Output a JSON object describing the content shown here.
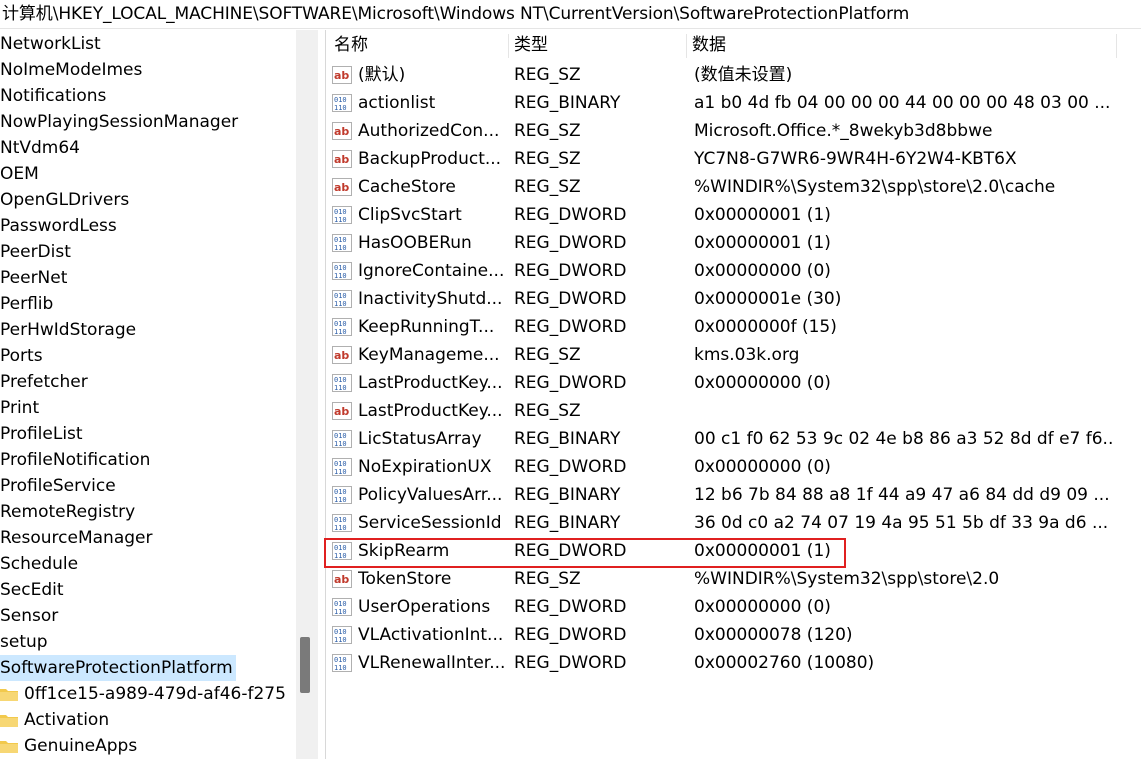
{
  "address": "计算机\\HKEY_LOCAL_MACHINE\\SOFTWARE\\Microsoft\\Windows NT\\CurrentVersion\\SoftwareProtectionPlatform",
  "tree": [
    {
      "label": "NetworkList"
    },
    {
      "label": "NoImeModeImes"
    },
    {
      "label": "Notifications"
    },
    {
      "label": "NowPlayingSessionManager"
    },
    {
      "label": "NtVdm64"
    },
    {
      "label": "OEM"
    },
    {
      "label": "OpenGLDrivers"
    },
    {
      "label": "PasswordLess"
    },
    {
      "label": "PeerDist"
    },
    {
      "label": "PeerNet"
    },
    {
      "label": "Perflib"
    },
    {
      "label": "PerHwIdStorage"
    },
    {
      "label": "Ports"
    },
    {
      "label": "Prefetcher"
    },
    {
      "label": "Print"
    },
    {
      "label": "ProfileList"
    },
    {
      "label": "ProfileNotification"
    },
    {
      "label": "ProfileService"
    },
    {
      "label": "RemoteRegistry"
    },
    {
      "label": "ResourceManager"
    },
    {
      "label": "Schedule"
    },
    {
      "label": "SecEdit"
    },
    {
      "label": "Sensor"
    },
    {
      "label": "setup"
    },
    {
      "label": "SoftwareProtectionPlatform",
      "selected": true
    },
    {
      "label": "0ff1ce15-a989-479d-af46-f275",
      "folder": true
    },
    {
      "label": "Activation",
      "folder": true
    },
    {
      "label": "GenuineApps",
      "folder": true
    }
  ],
  "columns": {
    "name": "名称",
    "type": "类型",
    "data": "数据"
  },
  "values": [
    {
      "name": "(默认)",
      "type": "REG_SZ",
      "data": "(数值未设置)",
      "icon": "string"
    },
    {
      "name": "actionlist",
      "type": "REG_BINARY",
      "data": "a1 b0 4d fb 04 00 00 00 44 00 00 00 48 03 00 ...",
      "icon": "binary"
    },
    {
      "name": "AuthorizedCon...",
      "type": "REG_SZ",
      "data": "Microsoft.Office.*_8wekyb3d8bbwe",
      "icon": "string"
    },
    {
      "name": "BackupProduct...",
      "type": "REG_SZ",
      "data": "YC7N8-G7WR6-9WR4H-6Y2W4-KBT6X",
      "icon": "string"
    },
    {
      "name": "CacheStore",
      "type": "REG_SZ",
      "data": "%WINDIR%\\System32\\spp\\store\\2.0\\cache",
      "icon": "string"
    },
    {
      "name": "ClipSvcStart",
      "type": "REG_DWORD",
      "data": "0x00000001 (1)",
      "icon": "binary"
    },
    {
      "name": "HasOOBERun",
      "type": "REG_DWORD",
      "data": "0x00000001 (1)",
      "icon": "binary"
    },
    {
      "name": "IgnoreContaine...",
      "type": "REG_DWORD",
      "data": "0x00000000 (0)",
      "icon": "binary"
    },
    {
      "name": "InactivityShutd...",
      "type": "REG_DWORD",
      "data": "0x0000001e (30)",
      "icon": "binary"
    },
    {
      "name": "KeepRunningT...",
      "type": "REG_DWORD",
      "data": "0x0000000f (15)",
      "icon": "binary"
    },
    {
      "name": "KeyManageme...",
      "type": "REG_SZ",
      "data": "kms.03k.org",
      "icon": "string"
    },
    {
      "name": "LastProductKey...",
      "type": "REG_DWORD",
      "data": "0x00000000 (0)",
      "icon": "binary"
    },
    {
      "name": "LastProductKey...",
      "type": "REG_SZ",
      "data": "",
      "icon": "string"
    },
    {
      "name": "LicStatusArray",
      "type": "REG_BINARY",
      "data": "00 c1 f0 62 53 9c 02 4e b8 86 a3 52 8d df e7 f6...",
      "icon": "binary"
    },
    {
      "name": "NoExpirationUX",
      "type": "REG_DWORD",
      "data": "0x00000000 (0)",
      "icon": "binary"
    },
    {
      "name": "PolicyValuesArr...",
      "type": "REG_BINARY",
      "data": "12 b6 7b 84 88 a8 1f 44 a9 47 a6 84 dd d9 09 ...",
      "icon": "binary"
    },
    {
      "name": "ServiceSessionId",
      "type": "REG_BINARY",
      "data": "36 0d c0 a2 74 07 19 4a 95 51 5b df 33 9a d6 ...",
      "icon": "binary"
    },
    {
      "name": "SkipRearm",
      "type": "REG_DWORD",
      "data": "0x00000001 (1)",
      "icon": "binary"
    },
    {
      "name": "TokenStore",
      "type": "REG_SZ",
      "data": "%WINDIR%\\System32\\spp\\store\\2.0",
      "icon": "string"
    },
    {
      "name": "UserOperations",
      "type": "REG_DWORD",
      "data": "0x00000000 (0)",
      "icon": "binary"
    },
    {
      "name": "VLActivationInt...",
      "type": "REG_DWORD",
      "data": "0x00000078 (120)",
      "icon": "binary"
    },
    {
      "name": "VLRenewalInter...",
      "type": "REG_DWORD",
      "data": "0x00002760 (10080)",
      "icon": "binary"
    }
  ],
  "colors": {
    "selection": "#cce8ff",
    "highlight_border": "#e02020",
    "folder": "#f2c94c"
  }
}
